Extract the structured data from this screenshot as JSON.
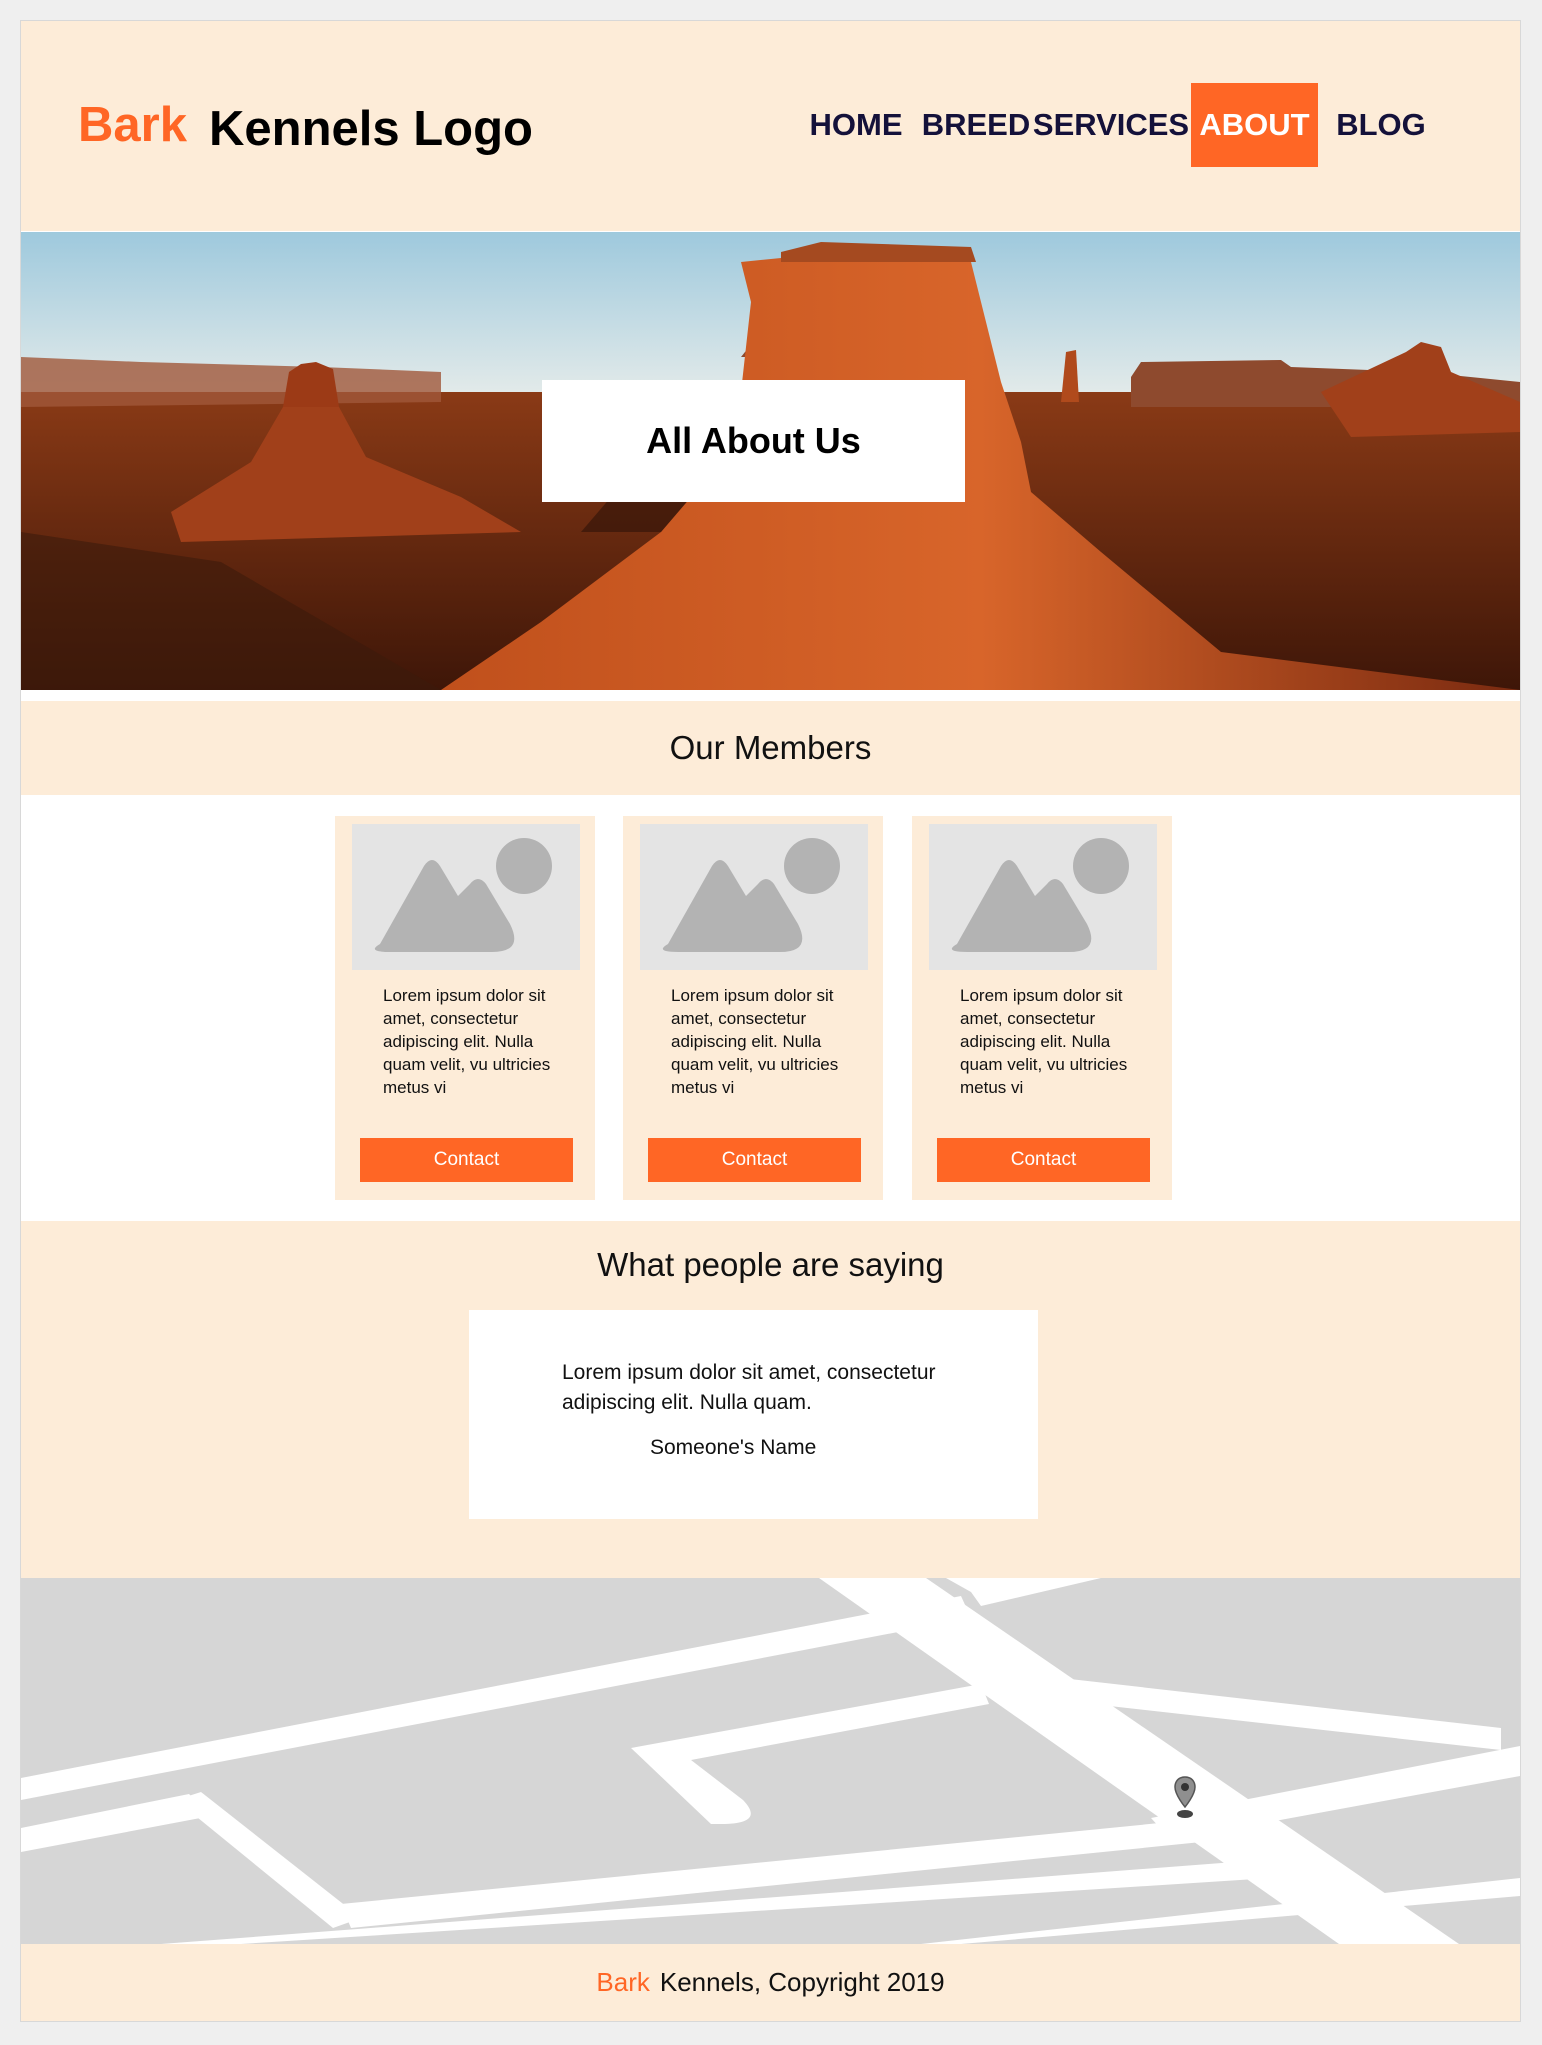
{
  "header": {
    "logo_highlight": "Bark",
    "logo_text": "Kennels Logo",
    "nav": [
      {
        "label": "HOME",
        "active": false
      },
      {
        "label": "BREED",
        "active": false
      },
      {
        "label": "SERVICES",
        "active": false
      },
      {
        "label": "ABOUT",
        "active": true
      },
      {
        "label": "BLOG",
        "active": false
      }
    ]
  },
  "hero": {
    "title": "All About Us",
    "image": "desert-mesa-landscape"
  },
  "members": {
    "title": "Our Members",
    "cards": [
      {
        "image": "image-placeholder-icon",
        "text": "Lorem ipsum dolor sit amet, consectetur adipiscing elit. Nulla quam velit, vu ultricies metus vi",
        "button": "Contact"
      },
      {
        "image": "image-placeholder-icon",
        "text": "Lorem ipsum dolor sit amet, consectetur adipiscing elit. Nulla quam velit, vu ultricies metus vi",
        "button": "Contact"
      },
      {
        "image": "image-placeholder-icon",
        "text": "Lorem ipsum dolor sit amet, consectetur adipiscing elit. Nulla quam velit, vu ultricies metus vi",
        "button": "Contact"
      }
    ]
  },
  "testimonials": {
    "title": "What people are saying",
    "quote": "Lorem ipsum dolor sit amet, consectetur adipiscing elit. Nulla quam.",
    "author": "Someone's Name"
  },
  "map": {
    "marker_icon": "map-pin-icon"
  },
  "footer": {
    "brand_highlight": "Bark",
    "text": "Kennels, Copyright 2019"
  },
  "colors": {
    "accent": "#ff6625",
    "band": "#fdecd8",
    "nav_text": "#14113a",
    "map_bg": "#d6d6d6"
  }
}
